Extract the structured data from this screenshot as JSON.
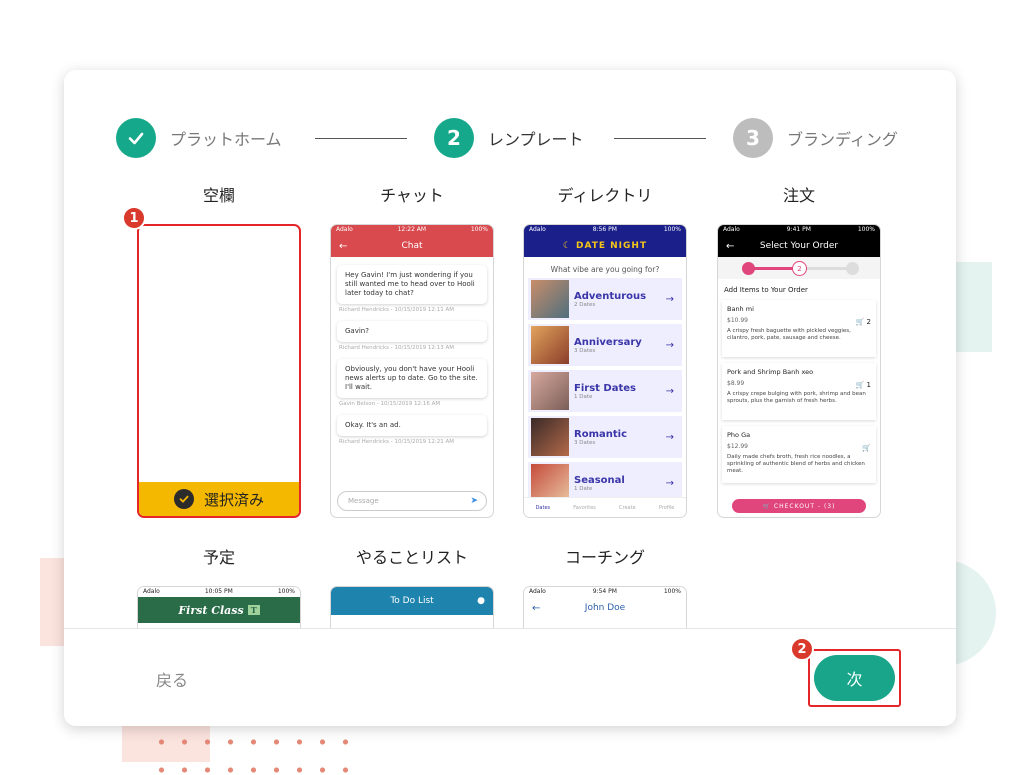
{
  "colors": {
    "accent": "#16a88b",
    "selected_bar": "#f5b800",
    "annotation": "#e4262a",
    "chat_header": "#d94a4f",
    "directory_header": "#1a1f8a",
    "order_header": "#000000",
    "planner_header": "#2a6b48",
    "todo_header": "#1e84ae",
    "checkout": "#e0457b"
  },
  "stepper": {
    "steps": [
      {
        "label": "プラットホーム",
        "state": "done",
        "icon": "check-icon"
      },
      {
        "number": "2",
        "label": "レンプレート",
        "state": "active"
      },
      {
        "number": "3",
        "label": "ブランディング",
        "state": "todo"
      }
    ]
  },
  "annotations": {
    "badge1": "1",
    "badge2": "2"
  },
  "templates": {
    "blank": {
      "title": "空欄",
      "selected_label": "選択済み"
    },
    "chat": {
      "title": "チャット",
      "status": {
        "carrier": "Adalo",
        "time": "12:22 AM",
        "battery": "100%"
      },
      "header": "Chat",
      "messages": [
        {
          "text": "Hey Gavin! I'm just wondering if you still wanted me to head over to Hooli later today to chat?",
          "meta": "Richard Hendricks - 10/15/2019 12:11 AM"
        },
        {
          "text": "Gavin?",
          "meta": "Richard Hendricks - 10/15/2019 12:13 AM"
        },
        {
          "text": "Obviously, you don't have your Hooli news alerts up to date. Go to the site. I'll wait.",
          "meta": "Gavin Belson - 10/15/2019 12:16 AM"
        },
        {
          "text": "Okay. It's an ad.",
          "meta": "Richard Hendricks - 10/15/2019 12:21 AM"
        }
      ],
      "input_placeholder": "Message"
    },
    "directory": {
      "title": "ディレクトリ",
      "status": {
        "carrier": "Adalo",
        "time": "8:56 PM",
        "battery": "100%"
      },
      "header": "DATE NIGHT",
      "question": "What vibe are you going for?",
      "items": [
        {
          "name": "Adventurous",
          "sub": "2 Dates"
        },
        {
          "name": "Anniversary",
          "sub": "3 Dates"
        },
        {
          "name": "First Dates",
          "sub": "1 Date"
        },
        {
          "name": "Romantic",
          "sub": "3 Dates"
        },
        {
          "name": "Seasonal",
          "sub": "1 Date"
        }
      ],
      "nav": [
        "Dates",
        "Favorites",
        "Create",
        "Profile"
      ]
    },
    "order": {
      "title": "注文",
      "status": {
        "carrier": "Adalo",
        "time": "9:41 PM",
        "battery": "100%"
      },
      "header": "Select Your Order",
      "progress_step": "2",
      "section": "Add Items to Your Order",
      "items": [
        {
          "name": "Banh mi",
          "price": "$10.99",
          "desc": "A crispy fresh baguette with pickled veggies, cilantro, pork, pate, sausage and cheese.",
          "qty": "2"
        },
        {
          "name": "Pork and Shrimp Banh xeo",
          "price": "$8.99",
          "desc": "A crispy crepe bulging with pork, shrimp and bean sprouts, plus the garnish of fresh herbs.",
          "qty": "1"
        },
        {
          "name": "Pho Ga",
          "price": "$12.99",
          "desc": "Daily made chefs broth, fresh rice noodles, a sprinkling of authentic blend of herbs and chicken meat.",
          "qty": ""
        }
      ],
      "checkout": "CHECKOUT - (3)"
    },
    "planner": {
      "title": "予定",
      "status": {
        "carrier": "Adalo",
        "time": "10:05 PM",
        "battery": "100%"
      },
      "header": "First Class"
    },
    "todo": {
      "title": "やることリスト",
      "header": "To Do List"
    },
    "coaching": {
      "title": "コーチング",
      "status": {
        "carrier": "Adalo",
        "time": "9:54 PM",
        "battery": "100%"
      },
      "header": "John Doe"
    }
  },
  "footer": {
    "back": "戻る",
    "next": "次"
  }
}
